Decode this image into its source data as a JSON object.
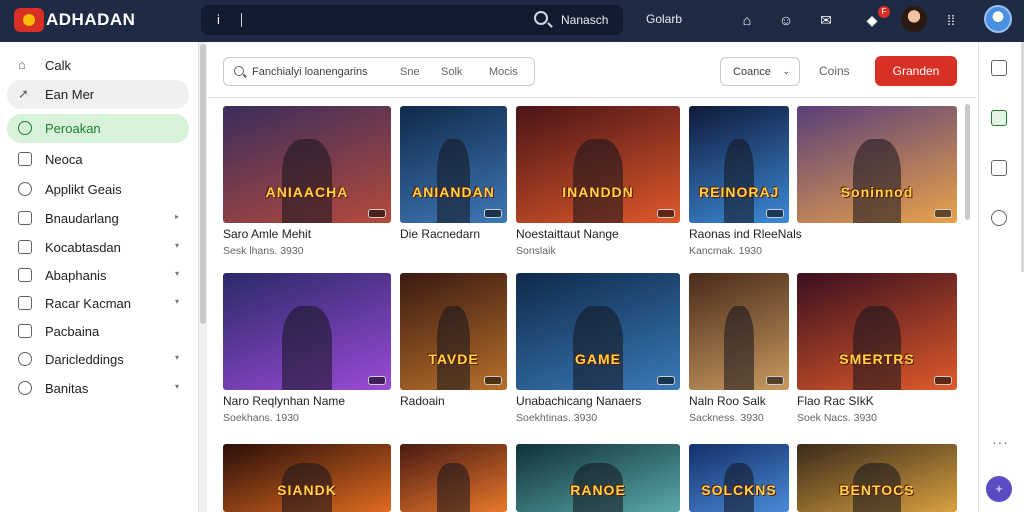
{
  "app": {
    "brand": "ADHADAN"
  },
  "topbar": {
    "search_prefix": "i",
    "search_text": "Nanasch",
    "link": "Golarb",
    "notification_count": "F"
  },
  "sidebar": {
    "items": [
      {
        "label": "Calk"
      },
      {
        "label": "Ean Mer"
      },
      {
        "label": "Peroakan"
      },
      {
        "label": "Neoca"
      },
      {
        "label": "Applikt Geais"
      },
      {
        "label": "Bnaudarlang"
      },
      {
        "label": "Kocabtasdan"
      },
      {
        "label": "Abaphanis"
      },
      {
        "label": "Racar Kacman"
      },
      {
        "label": "Pacbaina"
      },
      {
        "label": "Daricleddings"
      },
      {
        "label": "Banitas"
      }
    ]
  },
  "filter": {
    "search_text": "Fanchialyi loanengarins",
    "pills": [
      "Sne",
      "Solk",
      "Mocis"
    ],
    "dropdown_label": "Coance",
    "plain_button": "Coins",
    "primary_button": "Granden"
  },
  "games": [
    {
      "title": "Saro Amle Mehit",
      "sub": "Sesk lhans. 3930",
      "art": "ANIAACHA",
      "colors": [
        "#3a2d5c",
        "#b54a3c"
      ]
    },
    {
      "title": "Die Racnedarn",
      "sub": "",
      "art": "ANIANDAN",
      "colors": [
        "#102a4a",
        "#3f78b8"
      ]
    },
    {
      "title": "Noestaittaut Nange",
      "sub": "Sonslaik",
      "art": "INANDDN",
      "colors": [
        "#4a1418",
        "#e0592a"
      ]
    },
    {
      "title": "Raonas ind RleeNals",
      "sub": "Kancmak. 1930",
      "art": "REINORAJ",
      "colors": [
        "#101a3a",
        "#3d8ad8"
      ]
    },
    {
      "title": "",
      "sub": "",
      "art": "Soninnod",
      "colors": [
        "#5a3f7a",
        "#e9a24a"
      ]
    },
    {
      "title": "Naro Reqlynhan Name",
      "sub": "Soekhans. 1930",
      "art": "",
      "colors": [
        "#2b2a68",
        "#9b4ad8"
      ]
    },
    {
      "title": "Radoain",
      "sub": "",
      "art": "TAVDE",
      "colors": [
        "#3a1a12",
        "#b8702a"
      ]
    },
    {
      "title": "Unabachicang Nanaers",
      "sub": "Soekhtinas. 3930",
      "art": "GAME",
      "colors": [
        "#0f2a4a",
        "#3a7ab8"
      ]
    },
    {
      "title": "Naln Roo Salk",
      "sub": "Sackness. 3930",
      "art": "",
      "colors": [
        "#4a2a1a",
        "#c89a60"
      ]
    },
    {
      "title": "Flao Rac SIkK",
      "sub": "Soek Nacs. 3930",
      "art": "SMERTRS",
      "colors": [
        "#3a1020",
        "#e05a2a"
      ]
    },
    {
      "title": "",
      "sub": "",
      "art": "SIANDK",
      "colors": [
        "#2a0f0a",
        "#e06a20"
      ]
    },
    {
      "title": "",
      "sub": "",
      "art": "",
      "colors": [
        "#4a1a14",
        "#e8782a"
      ]
    },
    {
      "title": "",
      "sub": "",
      "art": "RANOE",
      "colors": [
        "#10323a",
        "#5aa8a8"
      ]
    },
    {
      "title": "",
      "sub": "",
      "art": "SOLCKNS",
      "colors": [
        "#14306a",
        "#4a8ad8"
      ]
    },
    {
      "title": "",
      "sub": "",
      "art": "BENTOCS",
      "colors": [
        "#3a2a1a",
        "#d8a040"
      ]
    }
  ],
  "accent": {
    "topbar": "#1f2a44",
    "primary": "#d93025",
    "selected": "#d8f2d9"
  }
}
